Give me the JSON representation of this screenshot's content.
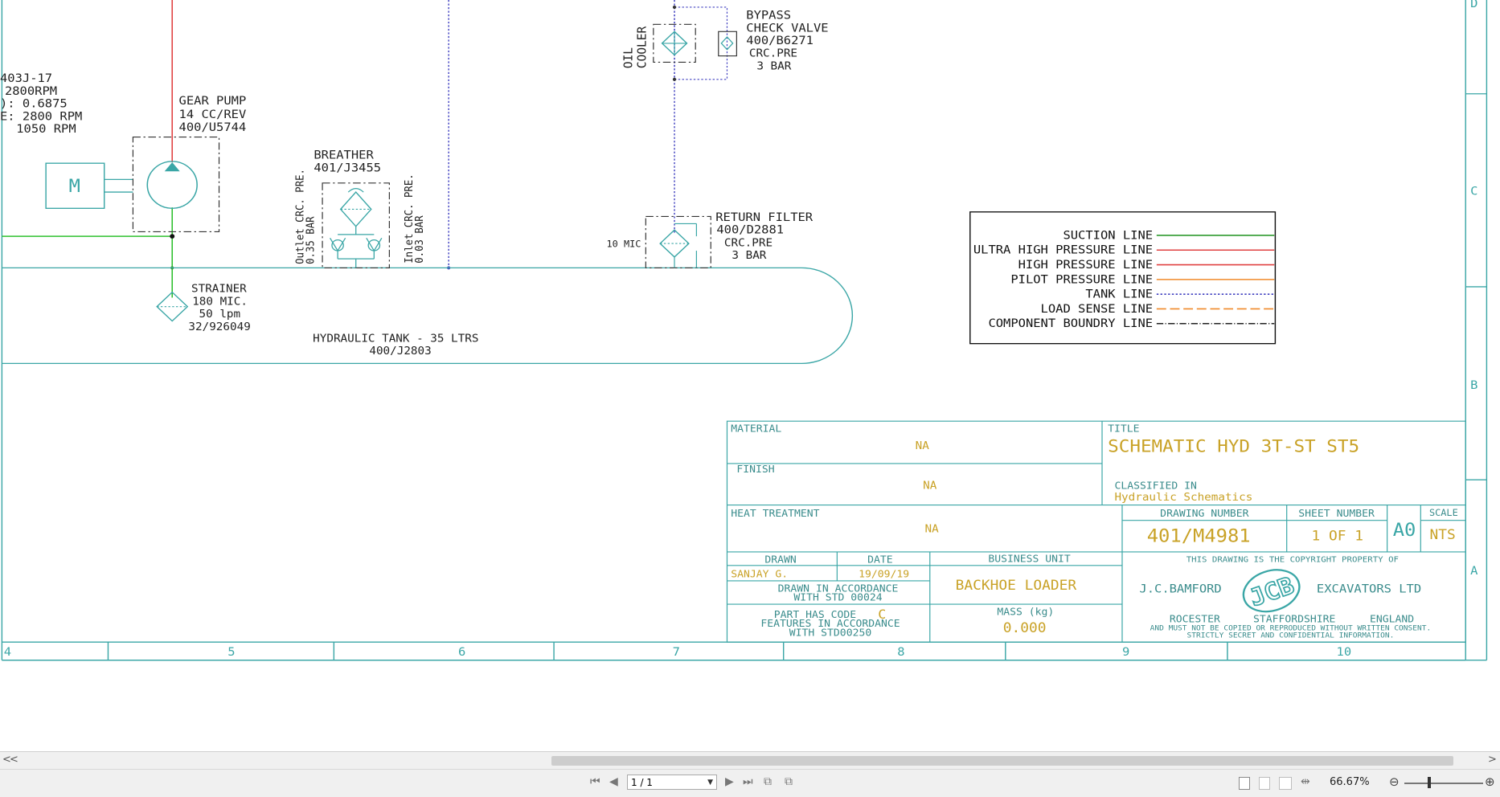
{
  "zones": {
    "bottom": [
      "4",
      "5",
      "6",
      "7",
      "8",
      "9",
      "10"
    ],
    "right": [
      "D",
      "C",
      "B",
      "A"
    ]
  },
  "components": {
    "motor": {
      "symbol": "M"
    },
    "motor_info": [
      "403J-17",
      "2800RPM",
      "): 0.6875",
      "E: 2800 RPM",
      "1050 RPM"
    ],
    "gear_pump": [
      "GEAR PUMP",
      "14 CC/REV",
      "400/U5744"
    ],
    "breather": [
      "BREATHER",
      "401/J3455"
    ],
    "breather_outlet": [
      "Outlet CRC. PRE.",
      "0.35 BAR"
    ],
    "breather_inlet": [
      "Inlet CRC. PRE.",
      "0.03 BAR"
    ],
    "strainer": [
      "STRAINER",
      "180 MIC.",
      "50 lpm",
      "32/926049"
    ],
    "tank": [
      "HYDRAULIC TANK - 35 LTRS",
      "400/J2803"
    ],
    "return_filter": [
      "RETURN FILTER",
      "400/D2881",
      "CRC.PRE",
      "3 BAR"
    ],
    "return_filter_mic": "10 MIC",
    "oil_cooler": [
      "OIL",
      "COOLER"
    ],
    "bypass_valve": [
      "BYPASS",
      "CHECK VALVE",
      "400/B6271",
      "CRC.PRE",
      "3 BAR"
    ]
  },
  "legend": {
    "items": [
      {
        "label": "SUCTION LINE",
        "color": "#2e9a2e",
        "style": "solid"
      },
      {
        "label": "ULTRA HIGH PRESSURE LINE",
        "color": "#e04040",
        "style": "solid"
      },
      {
        "label": "HIGH PRESSURE LINE",
        "color": "#e04040",
        "style": "solid"
      },
      {
        "label": "PILOT PRESSURE LINE",
        "color": "#f08a2a",
        "style": "solid"
      },
      {
        "label": "TANK LINE",
        "color": "#4040c0",
        "style": "dotted"
      },
      {
        "label": "LOAD SENSE LINE",
        "color": "#f08a2a",
        "style": "dashed"
      },
      {
        "label": "COMPONENT BOUNDRY LINE",
        "color": "#222222",
        "style": "dashdot"
      }
    ]
  },
  "title_block": {
    "material_label": "MATERIAL",
    "material_value": "NA",
    "finish_label": "FINISH",
    "finish_value": "NA",
    "heat_label": "HEAT TREATMENT",
    "heat_value": "NA",
    "title_label": "TITLE",
    "title_value": "SCHEMATIC HYD 3T-ST ST5",
    "classified_label": "CLASSIFIED IN",
    "classified_value": "Hydraulic Schematics",
    "drawing_number_label": "DRAWING NUMBER",
    "drawing_number": "401/M4981",
    "sheet_label": "SHEET NUMBER",
    "sheet_value": "1 OF 1",
    "size": "A0",
    "scale_label": "SCALE",
    "scale_value": "NTS",
    "drawn_label": "DRAWN",
    "drawn_value": "SANJAY G.",
    "date_label": "DATE",
    "date_value": "19/09/19",
    "bu_label": "BUSINESS UNIT",
    "bu_value": "BACKHOE LOADER",
    "accordance": [
      "DRAWN IN ACCORDANCE",
      "WITH STD 00024"
    ],
    "partcode_pre": "PART HAS CODE",
    "partcode_code": "C",
    "partcode_lines": [
      "FEATURES IN ACCORDANCE",
      "WITH STD00250"
    ],
    "mass_label": "MASS (kg)",
    "mass_value": "0.000",
    "copyright": "THIS DRAWING IS THE COPYRIGHT PROPERTY OF",
    "company_left": "J.C.BAMFORD",
    "company_right": "EXCAVATORS LTD",
    "logo": "JCB",
    "address": [
      "ROCESTER",
      "STAFFORDSHIRE",
      "ENGLAND"
    ],
    "notice": [
      "AND MUST NOT BE COPIED OR REPRODUCED WITHOUT WRITTEN CONSENT.",
      "STRICTLY SECRET AND CONFIDENTIAL INFORMATION."
    ]
  },
  "viewer": {
    "scroll_left": "<",
    "scroll_right": ">",
    "page_value": "1 / 1",
    "zoom": "66.67%",
    "zoom_out": "⊖",
    "zoom_in": "⊕"
  }
}
